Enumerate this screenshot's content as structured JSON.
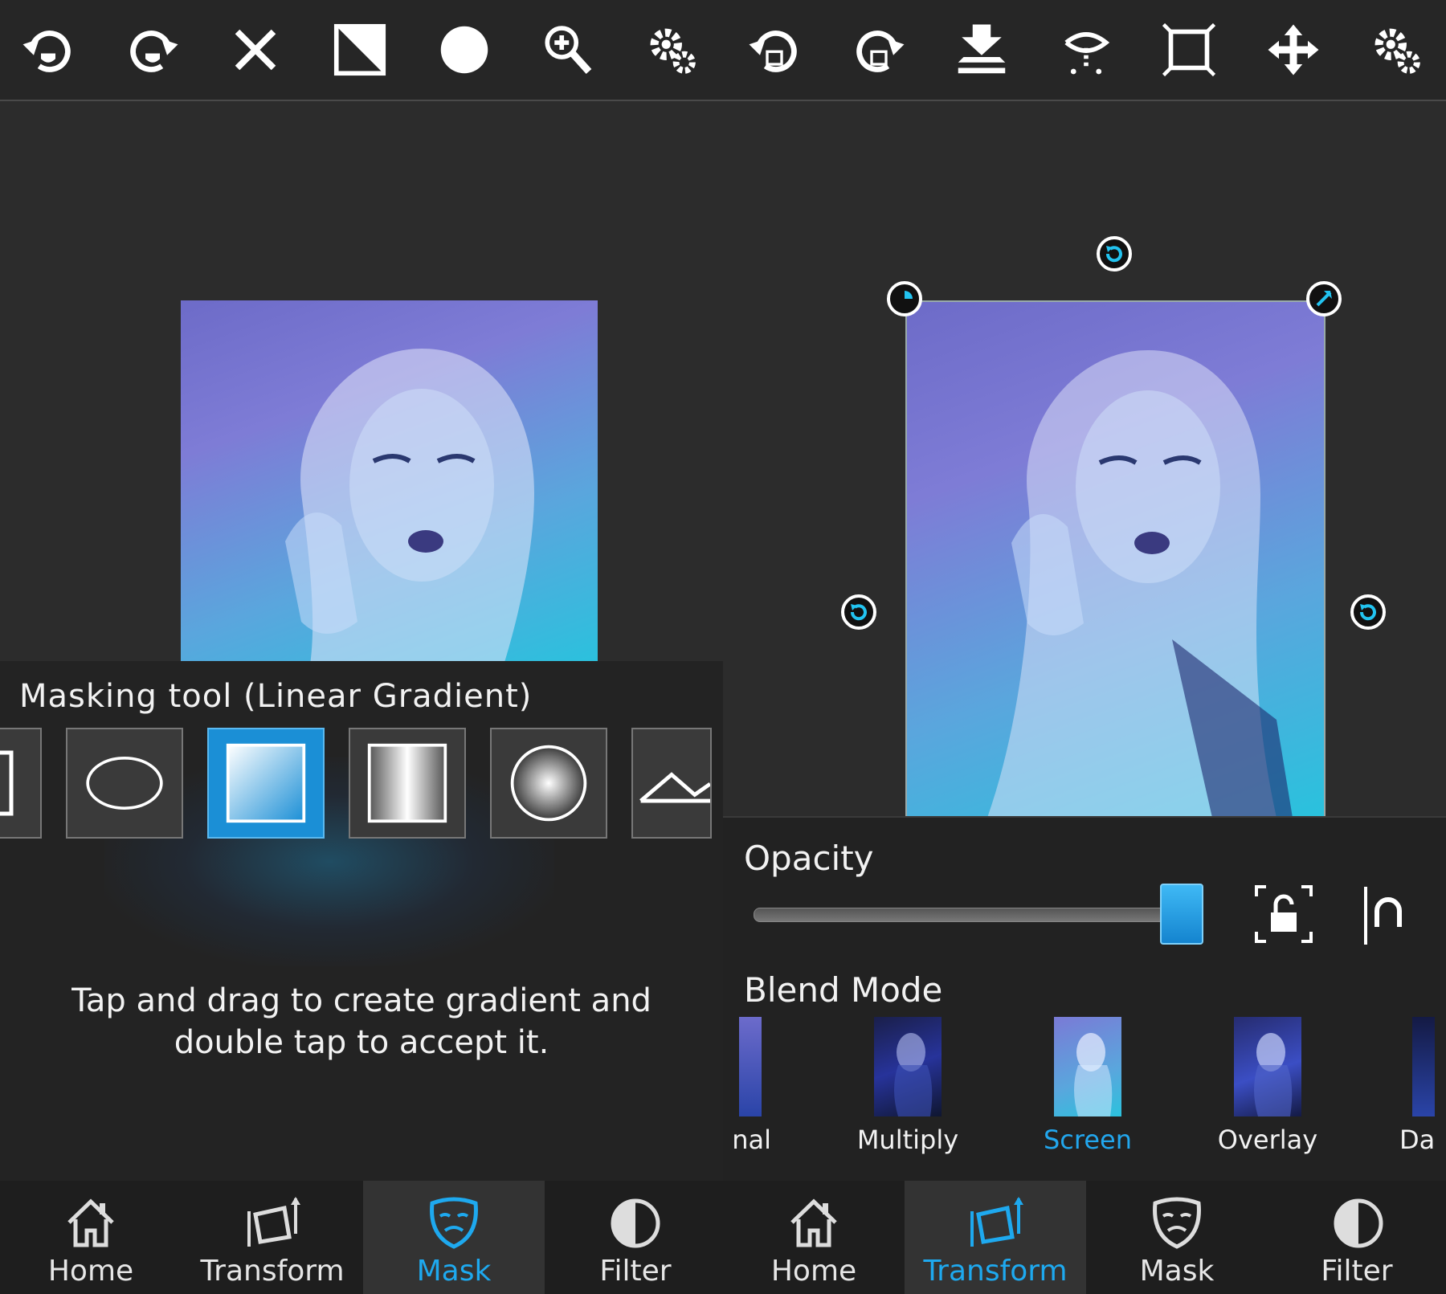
{
  "toolbar": {
    "icons": [
      "undo-mask-icon",
      "redo-mask-icon",
      "close-icon",
      "invert-mask-icon",
      "brush-icon",
      "zoom-in-icon",
      "settings-icon",
      "undo-transform-icon",
      "redo-transform-icon",
      "flatten-icon",
      "warp-icon",
      "crop-frame-icon",
      "move-icon",
      "settings-icon"
    ]
  },
  "mask_panel": {
    "title": "Masking tool (Linear Gradient)",
    "shapes": [
      "rectangle",
      "ellipse",
      "linear-gradient",
      "mirrored-gradient",
      "radial-gradient",
      "mountain"
    ],
    "selected_shape": "linear-gradient",
    "hint": "Tap and drag to create gradient and double tap to accept it."
  },
  "layer_panel": {
    "opacity_label": "Opacity",
    "opacity_value": 1.0,
    "blend_label": "Blend Mode",
    "blend_modes": [
      "nal",
      "Multiply",
      "Screen",
      "Overlay",
      "Da"
    ],
    "selected_blend": "Screen"
  },
  "nav_left": {
    "items": [
      "Home",
      "Transform",
      "Mask",
      "Filter"
    ],
    "active": "Mask"
  },
  "nav_right": {
    "items": [
      "Home",
      "Transform",
      "Mask",
      "Filter"
    ],
    "active": "Transform"
  },
  "colors": {
    "accent": "#1ea9ef",
    "bg": "#2b2b2b",
    "panel": "#232323"
  }
}
